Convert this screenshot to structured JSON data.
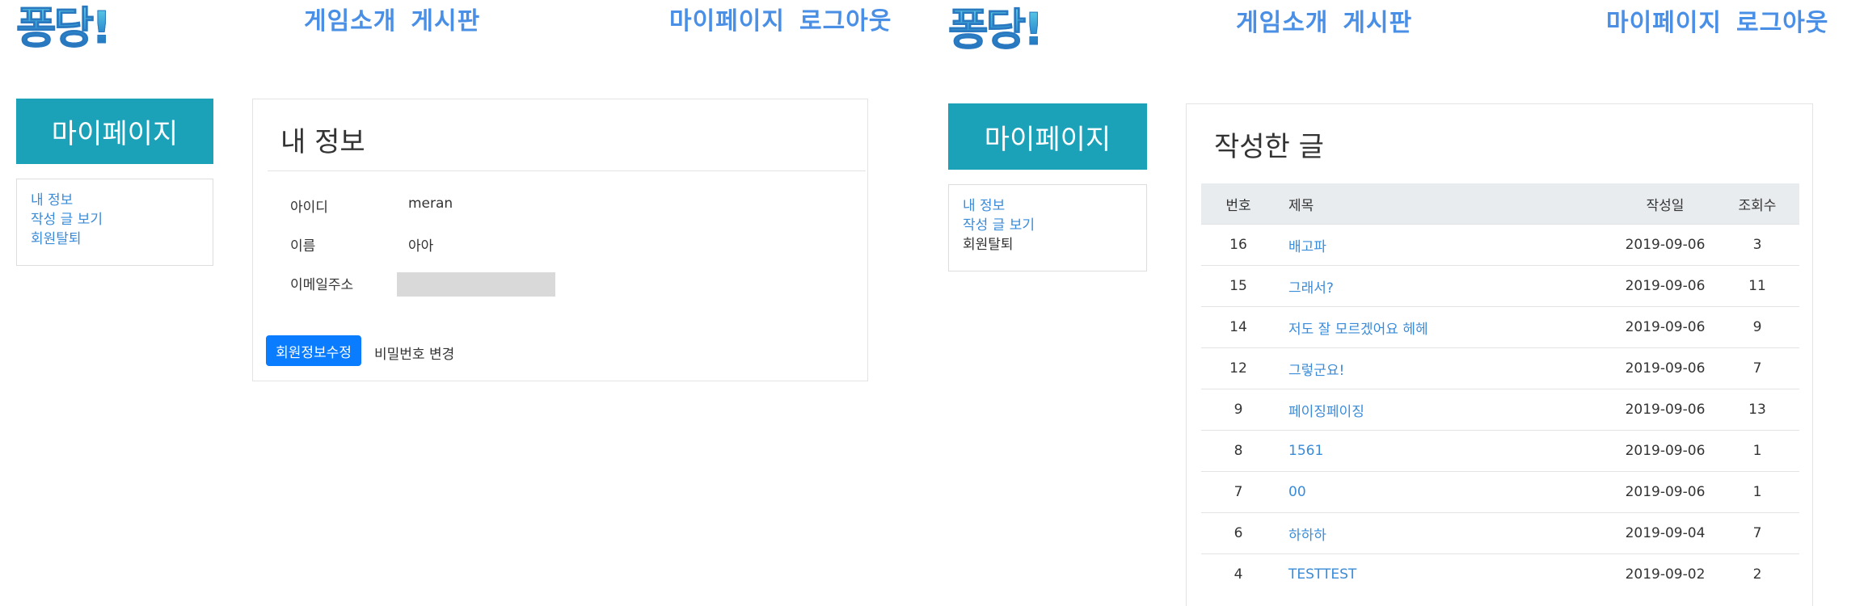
{
  "left": {
    "logo": "퐁당!",
    "nav": {
      "games": "게임소개",
      "board": "게시판",
      "mypage": "마이페이지",
      "logout": "로그아웃"
    },
    "sidebar": {
      "title": "마이페이지",
      "items": [
        {
          "label": "내 정보"
        },
        {
          "label": "작성 글 보기"
        },
        {
          "label": "회원탈퇴"
        }
      ]
    },
    "profile": {
      "title": "내 정보",
      "fields": [
        {
          "label": "아이디",
          "value": "meran"
        },
        {
          "label": "이름",
          "value": "아아"
        },
        {
          "label": "이메일주소",
          "value": ""
        }
      ],
      "edit_button": "회원정보수정",
      "password_button": "비밀번호 변경"
    }
  },
  "right": {
    "logo": "퐁당!",
    "nav": {
      "games": "게임소개",
      "board": "게시판",
      "mypage": "마이페이지",
      "logout": "로그아웃"
    },
    "sidebar": {
      "title": "마이페이지",
      "items": [
        {
          "label": "내 정보"
        },
        {
          "label": "작성 글 보기"
        },
        {
          "label": "회원탈퇴"
        }
      ]
    },
    "posts": {
      "title": "작성한 글",
      "headers": {
        "no": "번호",
        "title": "제목",
        "date": "작성일",
        "views": "조회수"
      },
      "rows": [
        {
          "no": "16",
          "title": "배고파",
          "date": "2019-09-06",
          "views": "3"
        },
        {
          "no": "15",
          "title": "그래서?",
          "date": "2019-09-06",
          "views": "11"
        },
        {
          "no": "14",
          "title": "저도 잘 모르겠어요 헤헤",
          "date": "2019-09-06",
          "views": "9"
        },
        {
          "no": "12",
          "title": "그렇군요!",
          "date": "2019-09-06",
          "views": "7"
        },
        {
          "no": "9",
          "title": "페이징페이징",
          "date": "2019-09-06",
          "views": "13"
        },
        {
          "no": "8",
          "title": "1561",
          "date": "2019-09-06",
          "views": "1"
        },
        {
          "no": "7",
          "title": "00",
          "date": "2019-09-06",
          "views": "1"
        },
        {
          "no": "6",
          "title": "하하하",
          "date": "2019-09-04",
          "views": "7"
        },
        {
          "no": "4",
          "title": "TESTTEST",
          "date": "2019-09-02",
          "views": "2"
        }
      ]
    }
  },
  "colors": {
    "accent": "#1ba1b8",
    "link": "#3a8bd8",
    "nav": "#4a8fe6",
    "primary_button": "#0a7cff"
  }
}
